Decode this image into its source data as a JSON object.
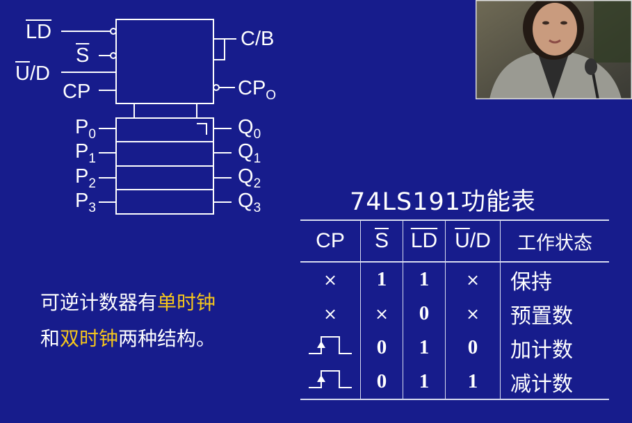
{
  "diagram": {
    "left_pins": [
      {
        "name": "LD",
        "overline": true
      },
      {
        "name": "S",
        "overline": true
      },
      {
        "name_over": "U",
        "name_rest": "/D"
      },
      {
        "name": "CP"
      }
    ],
    "right_pins": [
      {
        "name": "C/B"
      },
      {
        "name": "CP",
        "sub": "O"
      }
    ],
    "data_inputs": [
      {
        "name": "P",
        "sub": "0"
      },
      {
        "name": "P",
        "sub": "1"
      },
      {
        "name": "P",
        "sub": "2"
      },
      {
        "name": "P",
        "sub": "3"
      }
    ],
    "outputs": [
      {
        "name": "Q",
        "sub": "0"
      },
      {
        "name": "Q",
        "sub": "1"
      },
      {
        "name": "Q",
        "sub": "2"
      },
      {
        "name": "Q",
        "sub": "3"
      }
    ]
  },
  "table": {
    "title": "74LS191功能表",
    "headers": {
      "cp": "CP",
      "s": "S",
      "ld": "LD",
      "ud_over": "U",
      "ud_rest": "/D",
      "state": "工作状态"
    },
    "rows": [
      {
        "cp": "×",
        "s": "1",
        "ld": "1",
        "ud": "×",
        "state": "保持"
      },
      {
        "cp": "×",
        "s": "×",
        "ld": "0",
        "ud": "×",
        "state": "预置数"
      },
      {
        "cp_icon": "rising-edge-pulse",
        "s": "0",
        "ld": "1",
        "ud": "0",
        "state": "加计数"
      },
      {
        "cp_icon": "rising-edge-pulse",
        "s": "0",
        "ld": "1",
        "ud": "1",
        "state": "减计数"
      }
    ]
  },
  "description": {
    "line1_a": "可逆计数器有",
    "line1_b": "单时钟",
    "line2_a": "和",
    "line2_b": "双时钟",
    "line2_c": "两种结构。"
  },
  "colors": {
    "background": "#171c8c",
    "highlight": "#f5c61c",
    "text": "#ffffff"
  }
}
